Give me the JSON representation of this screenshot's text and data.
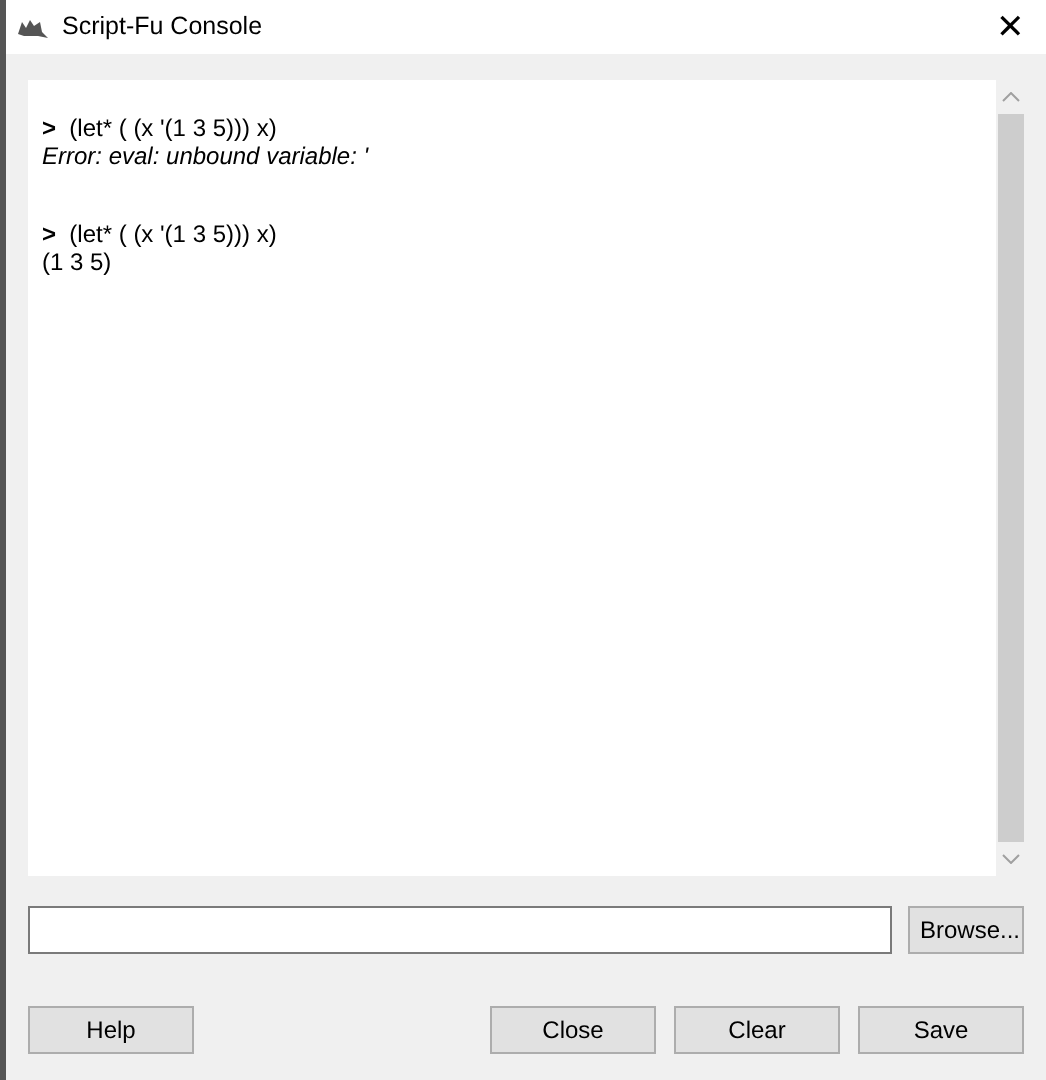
{
  "window": {
    "title": "Script-Fu Console",
    "close": "✕"
  },
  "console": {
    "lines": [
      {
        "kind": "input",
        "prompt": ">",
        "text": "(let* ( (x '(1 3 5))) x)"
      },
      {
        "kind": "error",
        "text": "Error: eval: unbound variable: '"
      },
      {
        "kind": "input",
        "prompt": ">",
        "text": "(let* ( (x '(1 3 5))) x)"
      },
      {
        "kind": "result",
        "text": "(1 3 5)"
      }
    ]
  },
  "entry": {
    "browse": "Browse..."
  },
  "buttons": [
    {
      "label": "Help",
      "kind": "left"
    },
    {
      "label": "Close",
      "kind": "right"
    },
    {
      "label": "Clear",
      "kind": "right"
    },
    {
      "label": "Save",
      "kind": "right"
    }
  ]
}
